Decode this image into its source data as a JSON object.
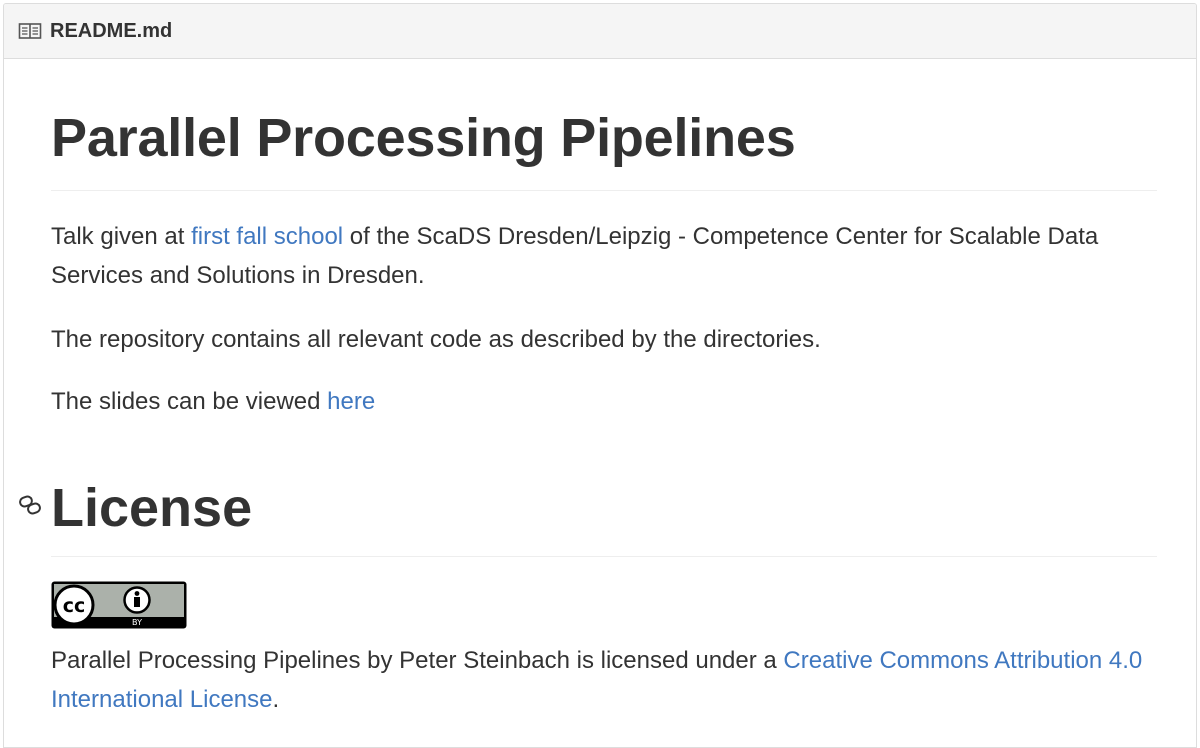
{
  "header": {
    "icon": "book-icon",
    "filename": "README.md"
  },
  "readme": {
    "title": "Parallel Processing Pipelines",
    "intro": {
      "before": "Talk given at ",
      "link": "first fall school",
      "after": " of the ScaDS Dresden/Leipzig - Competence Center for Scalable Data Services and Solutions in Dresden."
    },
    "repo_text": "The repository contains all relevant code as described by the directories.",
    "slides": {
      "before": "The slides can be viewed ",
      "link": "here"
    },
    "license_heading": "License",
    "license_anchor_icon": "link-icon",
    "badge": {
      "icon": "cc-by-badge-icon",
      "label": "BY"
    },
    "license_text": {
      "before": "Parallel Processing Pipelines by Peter Steinbach is licensed under a ",
      "link": "Creative Commons Attribution 4.0 International License",
      "after": "."
    }
  },
  "colors": {
    "link": "#4078c0",
    "text": "#333333",
    "header_bg": "#f5f5f5",
    "border": "#dddddd"
  }
}
